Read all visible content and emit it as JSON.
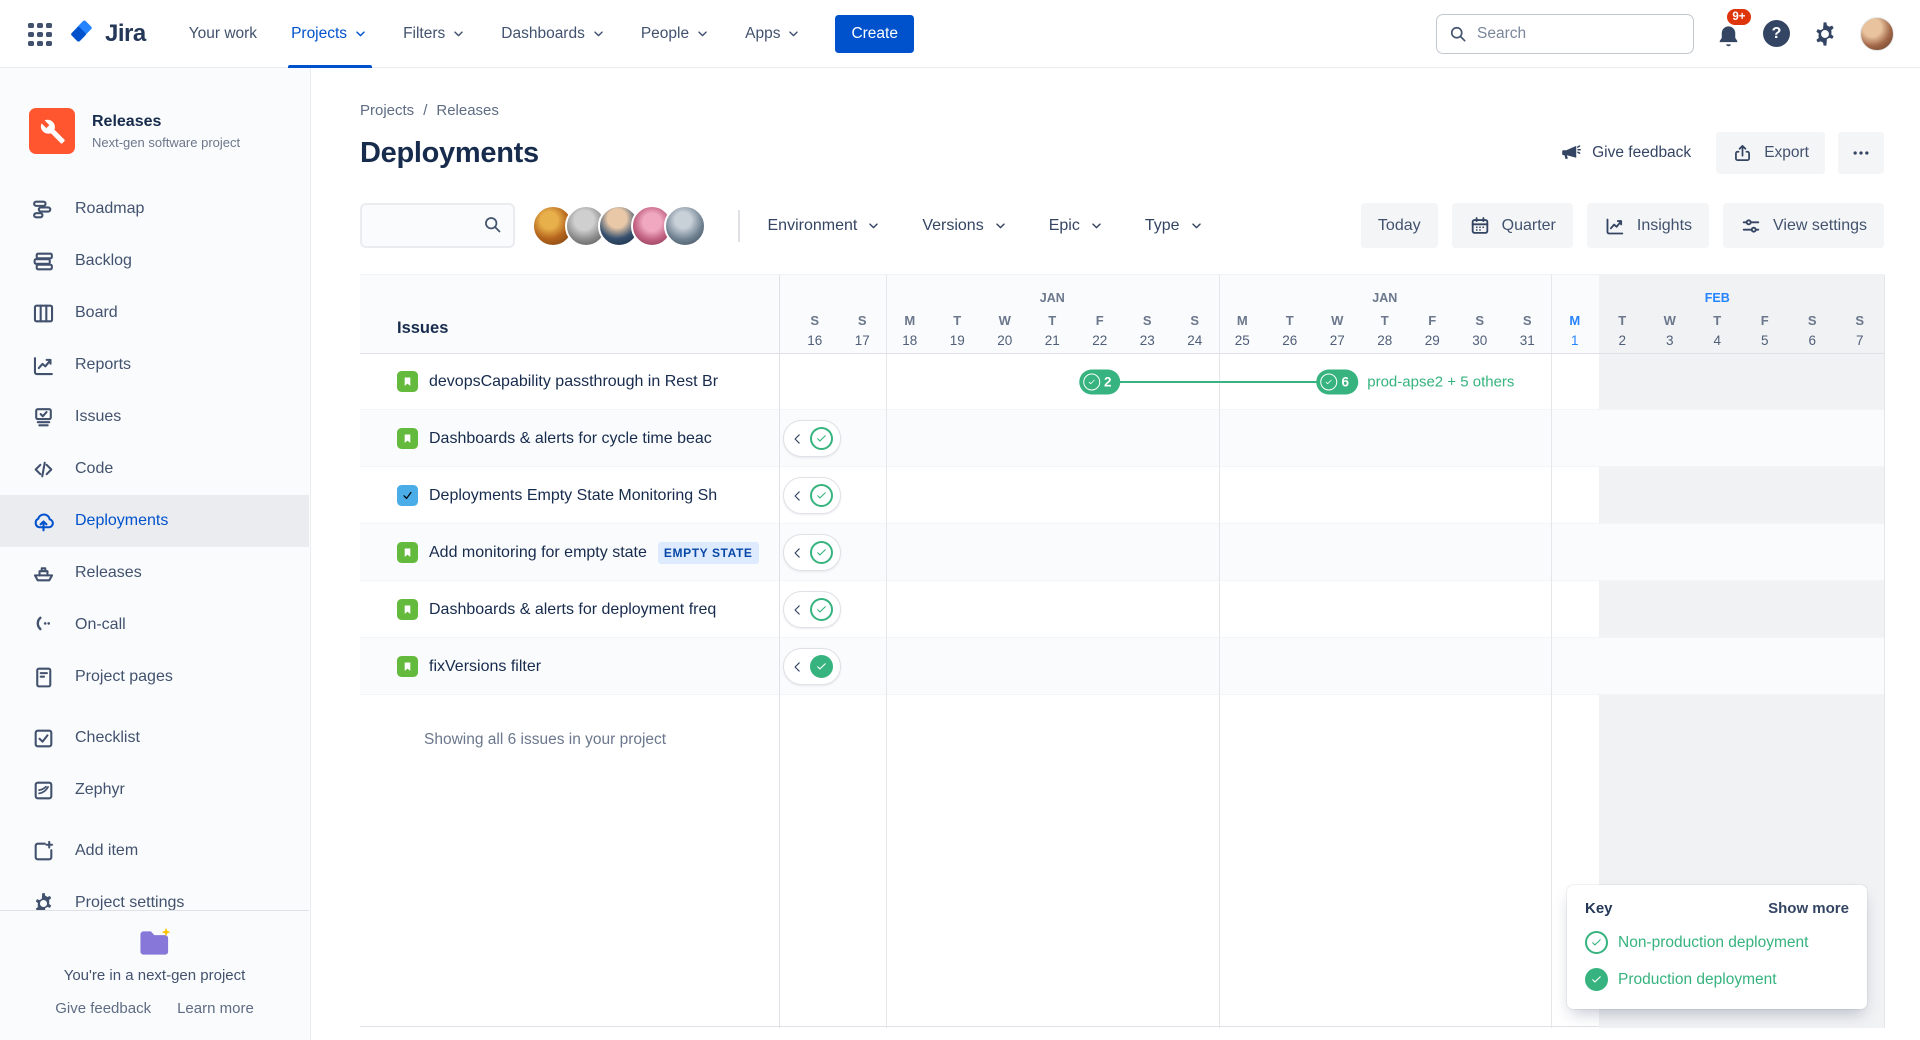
{
  "topnav": {
    "logo_text": "Jira",
    "items": [
      {
        "label": "Your work",
        "chevron": false,
        "active": false
      },
      {
        "label": "Projects",
        "chevron": true,
        "active": true
      },
      {
        "label": "Filters",
        "chevron": true,
        "active": false
      },
      {
        "label": "Dashboards",
        "chevron": true,
        "active": false
      },
      {
        "label": "People",
        "chevron": true,
        "active": false
      },
      {
        "label": "Apps",
        "chevron": true,
        "active": false
      }
    ],
    "create_label": "Create",
    "search": {
      "placeholder": "Search",
      "value": ""
    },
    "notifications_badge": "9+"
  },
  "sidebar": {
    "project": {
      "name": "Releases",
      "subtitle": "Next-gen software project"
    },
    "items": [
      {
        "label": "Roadmap",
        "icon": "roadmap",
        "selected": false,
        "gap_before": false
      },
      {
        "label": "Backlog",
        "icon": "backlog",
        "selected": false,
        "gap_before": false
      },
      {
        "label": "Board",
        "icon": "board",
        "selected": false,
        "gap_before": false
      },
      {
        "label": "Reports",
        "icon": "reports",
        "selected": false,
        "gap_before": false
      },
      {
        "label": "Issues",
        "icon": "issues",
        "selected": false,
        "gap_before": false
      },
      {
        "label": "Code",
        "icon": "code",
        "selected": false,
        "gap_before": false
      },
      {
        "label": "Deployments",
        "icon": "deployments",
        "selected": true,
        "gap_before": false
      },
      {
        "label": "Releases",
        "icon": "ship",
        "selected": false,
        "gap_before": false
      },
      {
        "label": "On-call",
        "icon": "phone",
        "selected": false,
        "gap_before": false
      },
      {
        "label": "Project pages",
        "icon": "pages",
        "selected": false,
        "gap_before": false
      },
      {
        "label": "Checklist",
        "icon": "checklist",
        "selected": false,
        "gap_before": true
      },
      {
        "label": "Zephyr",
        "icon": "zephyr",
        "selected": false,
        "gap_before": false
      },
      {
        "label": "Add item",
        "icon": "add-item",
        "selected": false,
        "gap_before": true
      },
      {
        "label": "Project settings",
        "icon": "gear",
        "selected": false,
        "gap_before": false
      }
    ],
    "footer": {
      "message": "You're in a next-gen project",
      "links": [
        "Give feedback",
        "Learn more"
      ]
    }
  },
  "page_header": {
    "breadcrumbs": [
      "Projects",
      "Releases"
    ],
    "title": "Deployments",
    "give_feedback": "Give feedback",
    "export_label": "Export"
  },
  "filter_bar": {
    "search_value": "",
    "avatar_count": 5,
    "dropdowns": [
      "Environment",
      "Versions",
      "Epic",
      "Type"
    ],
    "today_label": "Today",
    "buttons": [
      {
        "label": "Quarter",
        "icon": "calendar"
      },
      {
        "label": "Insights",
        "icon": "chart"
      },
      {
        "label": "View settings",
        "icon": "sliders"
      }
    ]
  },
  "chart_data": {
    "type": "timeline",
    "issues_header": "Issues",
    "days": [
      [
        "S",
        "16"
      ],
      [
        "S",
        "17"
      ],
      [
        "M",
        "18"
      ],
      [
        "T",
        "19"
      ],
      [
        "W",
        "20"
      ],
      [
        "T",
        "21"
      ],
      [
        "F",
        "22"
      ],
      [
        "S",
        "23"
      ],
      [
        "S",
        "24"
      ],
      [
        "M",
        "25"
      ],
      [
        "T",
        "26"
      ],
      [
        "W",
        "27"
      ],
      [
        "T",
        "28"
      ],
      [
        "F",
        "29"
      ],
      [
        "S",
        "30"
      ],
      [
        "S",
        "31"
      ],
      [
        "M",
        "1"
      ],
      [
        "T",
        "2"
      ],
      [
        "W",
        "3"
      ],
      [
        "T",
        "4"
      ],
      [
        "F",
        "5"
      ],
      [
        "S",
        "6"
      ],
      [
        "S",
        "7"
      ]
    ],
    "months": [
      {
        "label": "JAN",
        "day_index": 5,
        "accent": false
      },
      {
        "label": "JAN",
        "day_index": 12,
        "accent": false
      },
      {
        "label": "FEB",
        "day_index": 19,
        "accent": true
      }
    ],
    "today_day_index": 16,
    "shaded_from_day_index": 17,
    "week_line_indices": [
      2,
      9,
      16,
      23
    ],
    "rows": [
      {
        "type": "story",
        "title": "devopsCapability passthrough in Rest Br",
        "lozenge": "",
        "edge_marker": "",
        "deployments": {
          "start": {
            "count": "2",
            "day_index": 6
          },
          "end": {
            "count": "6",
            "day_index": 11,
            "label": "prod-apse2 + 5 others"
          }
        }
      },
      {
        "type": "story",
        "title": "Dashboards & alerts for cycle time beac",
        "lozenge": "",
        "edge_marker": "non-production",
        "deployments": null
      },
      {
        "type": "task",
        "title": "Deployments Empty State Monitoring Sh",
        "lozenge": "",
        "edge_marker": "non-production",
        "deployments": null
      },
      {
        "type": "story",
        "title": "Add monitoring for empty state",
        "lozenge": "EMPTY STATE",
        "edge_marker": "non-production",
        "deployments": null
      },
      {
        "type": "story",
        "title": "Dashboards & alerts for deployment freq",
        "lozenge": "",
        "edge_marker": "non-production",
        "deployments": null
      },
      {
        "type": "story",
        "title": "fixVersions filter",
        "lozenge": "",
        "edge_marker": "production",
        "deployments": null
      }
    ],
    "footer_note": "Showing all 6 issues in your project"
  },
  "key_panel": {
    "title": "Key",
    "show_more": "Show more",
    "items": [
      {
        "label": "Non-production deployment",
        "marker": "non-production"
      },
      {
        "label": "Production deployment",
        "marker": "production"
      }
    ]
  },
  "colors": {
    "brand": "#0052CC",
    "deployment_green": "#36B37E",
    "story_green": "#63BA3C",
    "task_blue": "#4BADE8",
    "notification_red": "#DE350B",
    "project_icon_orange": "#FF5630",
    "folder_purple": "#8777D9",
    "today_accent": "#2684FF"
  }
}
